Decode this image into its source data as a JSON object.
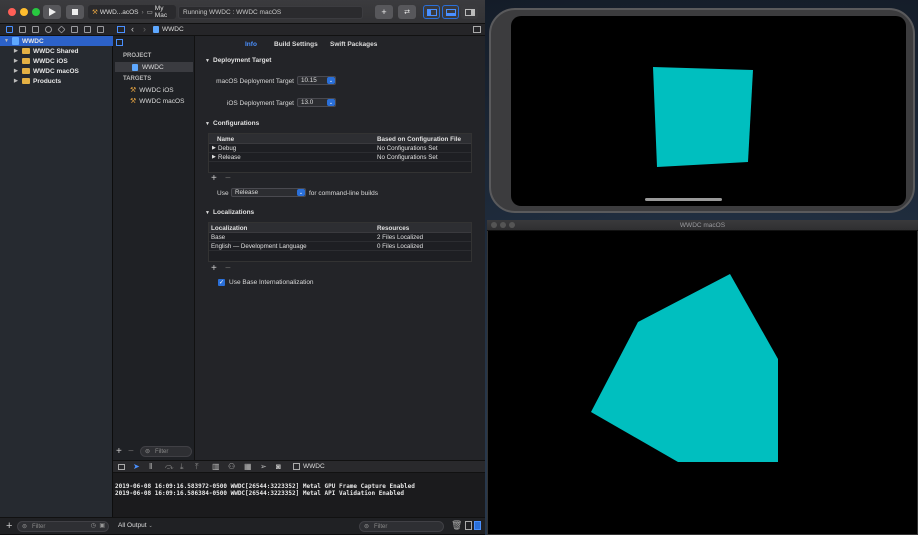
{
  "toolbar": {
    "scheme_target": "WWD...acOS",
    "scheme_device": "My Mac",
    "activity": "Running WWDC : WWDC macOS",
    "add_label": "+",
    "colors": {
      "close": "#ff5f57",
      "minimize": "#febc2e",
      "maximize": "#28c840",
      "accent": "#2a6fd8"
    }
  },
  "navigator": {
    "items": [
      {
        "label": "WWDC",
        "level": 0
      },
      {
        "label": "WWDC Shared",
        "level": 1
      },
      {
        "label": "WWDC iOS",
        "level": 1
      },
      {
        "label": "WWDC macOS",
        "level": 1
      },
      {
        "label": "Products",
        "level": 1
      }
    ],
    "filter_placeholder": "Filter"
  },
  "jumpbar": {
    "file": "WWDC"
  },
  "project_list": {
    "project_header": "PROJECT",
    "project": "WWDC",
    "targets_header": "TARGETS",
    "targets": [
      "WWDC iOS",
      "WWDC macOS"
    ],
    "filter_placeholder": "Filter"
  },
  "editor": {
    "tabs": [
      "Info",
      "Build Settings",
      "Swift Packages"
    ],
    "deployment": {
      "title": "Deployment Target",
      "macos_label": "macOS Deployment Target",
      "macos_value": "10.15",
      "ios_label": "iOS Deployment Target",
      "ios_value": "13.0"
    },
    "configurations": {
      "title": "Configurations",
      "headers": [
        "Name",
        "Based on Configuration File"
      ],
      "rows": [
        [
          "Debug",
          "No Configurations Set"
        ],
        [
          "Release",
          "No Configurations Set"
        ]
      ],
      "use_label": "Use",
      "use_value": "Release",
      "use_suffix": "for command-line builds"
    },
    "localizations": {
      "title": "Localizations",
      "headers": [
        "Localization",
        "Resources"
      ],
      "rows": [
        [
          "Base",
          "2 Files Localized"
        ],
        [
          "English — Development Language",
          "0 Files Localized"
        ]
      ],
      "checkbox_label": "Use Base Internationalization",
      "checkbox_checked": true
    }
  },
  "debug": {
    "process": "WWDC",
    "log": [
      "2019-06-08 16:09:16.583972-0500 WWDC[26544:3223352] Metal GPU Frame Capture Enabled",
      "2019-06-08 16:09:16.586384-0500 WWDC[26544:3223352] Metal API Validation Enabled"
    ],
    "output_label": "All Output",
    "filter_placeholder": "Filter"
  },
  "mac_window": {
    "title": "WWDC macOS"
  },
  "render": {
    "shape_color": "#00bfbf"
  }
}
